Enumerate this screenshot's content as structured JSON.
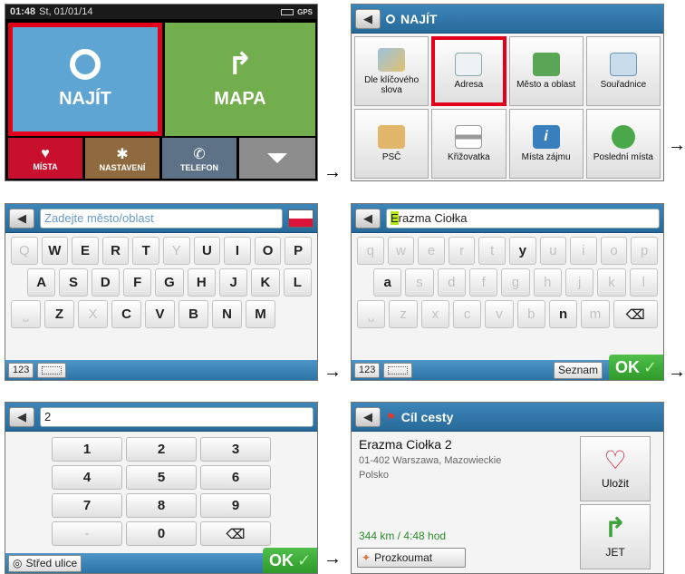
{
  "screen1": {
    "status_time": "01:48",
    "status_date": "St, 01/01/14",
    "gps": "GPS",
    "find": "NAJÍT",
    "map": "MAPA",
    "places": "MÍSTA",
    "settings": "NASTAVENÍ",
    "phone": "TELEFON"
  },
  "screen2": {
    "title": "NAJÍT",
    "items": [
      {
        "label": "Dle klíčového slova"
      },
      {
        "label": "Adresa"
      },
      {
        "label": "Město a oblast"
      },
      {
        "label": "Souřadnice"
      },
      {
        "label": "PSČ"
      },
      {
        "label": "Křižovatka"
      },
      {
        "label": "Místa zájmu"
      },
      {
        "label": "Poslední místa"
      }
    ]
  },
  "screen3": {
    "placeholder": "Zadejte město/oblast",
    "rows": [
      [
        "Q",
        "W",
        "E",
        "R",
        "T",
        "Y",
        "U",
        "I",
        "O",
        "P"
      ],
      [
        "A",
        "S",
        "D",
        "F",
        "G",
        "H",
        "J",
        "K",
        "L"
      ],
      [
        "⎵",
        "Z",
        "X",
        "C",
        "V",
        "B",
        "N",
        "M"
      ]
    ],
    "mode": "123"
  },
  "screen4": {
    "input_first": "E",
    "input_rest": "razma Ciołka",
    "rows": [
      [
        "q",
        "w",
        "e",
        "r",
        "t",
        "y",
        "u",
        "i",
        "o",
        "p"
      ],
      [
        "a",
        "s",
        "d",
        "f",
        "g",
        "h",
        "j",
        "k",
        "l"
      ],
      [
        "⎵",
        "z",
        "x",
        "c",
        "v",
        "b",
        "n",
        "m",
        "⌫"
      ]
    ],
    "mode": "123",
    "list": "Seznam",
    "ok": "OK"
  },
  "screen5": {
    "input": "2",
    "keys": [
      "1",
      "2",
      "3",
      "4",
      "5",
      "6",
      "7",
      "8",
      "9",
      "-",
      "0",
      "⌫"
    ],
    "center": "Střed ulice",
    "ok": "OK"
  },
  "screen6": {
    "title": "Cíl cesty",
    "street": "Erazma Ciołka 2",
    "city": "01-402 Warszawa, Mazowieckie",
    "country": "Polsko",
    "distance": "344 km / 4:48 hod",
    "explore": "Prozkoumat",
    "save": "Uložit",
    "go": "JET"
  },
  "arrow": "→",
  "colors": {
    "highlight": "#e3001b",
    "blue": "#2f7bb2",
    "green": "#79b64a",
    "red": "#c8102e"
  }
}
